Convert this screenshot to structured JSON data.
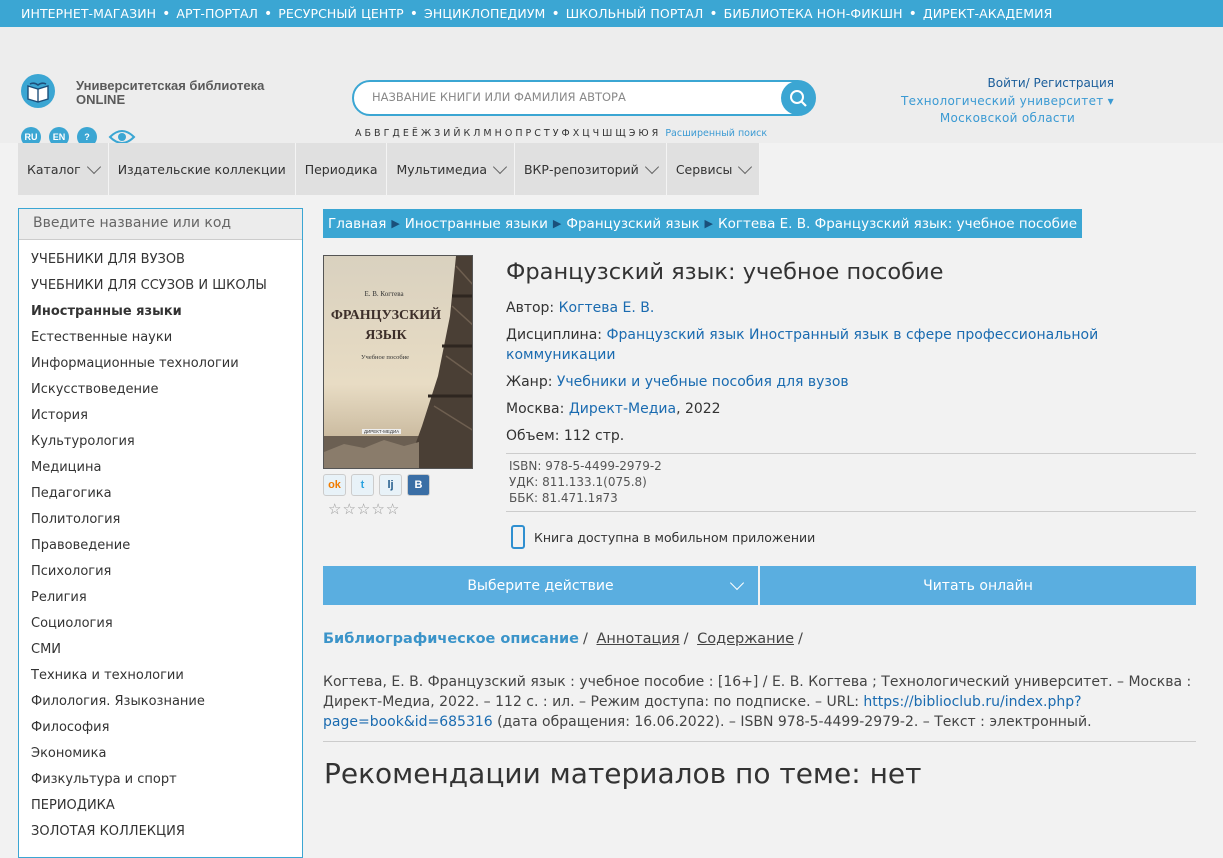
{
  "topbar": {
    "links": [
      "ИНТЕРНЕТ-МАГАЗИН",
      "АРТ-ПОРТАЛ",
      "РЕСУРСНЫЙ ЦЕНТР",
      "ЭНЦИКЛОПЕДИУМ",
      "ШКОЛЬНЫЙ ПОРТАЛ",
      "БИБЛИОТЕКА НОН-ФИКШН",
      "ДИРЕКТ-АКАДЕМИЯ"
    ]
  },
  "header": {
    "logo_line1": "Университетская библиотека",
    "logo_line2": "ONLINE",
    "lang": {
      "ru": "RU",
      "en": "EN",
      "help": "?"
    },
    "search_placeholder": "НАЗВАНИЕ КНИГИ ИЛИ ФАМИЛИЯ АВТОРА",
    "alphabet": "А Б В Г Д Е Ё Ж З И Й К Л М Н О П Р С Т У Ф Х Ц Ч Ш Щ Э Ю Я",
    "advanced_search": "Расширенный поиск",
    "login": "Войти/ Регистрация",
    "org_line1": "Технологический университет ▾",
    "org_line2": "Московской области"
  },
  "nav": {
    "catalog": "Каталог",
    "collections": "Издательские коллекции",
    "periodicals": "Периодика",
    "multimedia": "Мультимедиа",
    "vkr": "ВКР-репозиторий",
    "services": "Сервисы"
  },
  "sidebar": {
    "search_placeholder": "Введите название или код",
    "items": [
      "УЧЕБНИКИ ДЛЯ ВУЗОВ",
      "УЧЕБНИКИ ДЛЯ ССУЗОВ И ШКОЛЫ",
      "Иностранные языки",
      "Естественные науки",
      "Информационные технологии",
      "Искусствоведение",
      "История",
      "Культурология",
      "Медицина",
      "Педагогика",
      "Политология",
      "Правоведение",
      "Психология",
      "Религия",
      "Социология",
      "СМИ",
      "Техника и технологии",
      "Филология. Языкознание",
      "Философия",
      "Экономика",
      "Физкультура и спорт",
      "ПЕРИОДИКА",
      "ЗОЛОТАЯ КОЛЛЕКЦИЯ"
    ],
    "active": "Иностранные языки"
  },
  "breadcrumb": [
    "Главная",
    "Иностранные языки",
    "Французский язык",
    "Когтева Е. В. Французский язык: учебное пособие"
  ],
  "book": {
    "cover_author": "Е. В. Когтева",
    "cover_title_1": "ФРАНЦУЗСКИЙ",
    "cover_title_2": "ЯЗЫК",
    "cover_subtitle": "Учебное пособие",
    "cover_publisher": "ДИРЕКТ-МЕДИА",
    "title": "Французский язык: учебное пособие",
    "author_label": "Автор:",
    "author": "Когтева Е. В.",
    "discipline_label": "Дисциплина:",
    "discipline_1": "Французский язык",
    "discipline_2": "Иностранный язык в сфере профессиональной",
    "discipline_3": "коммуникации",
    "genre_label": "Жанр:",
    "genre": "Учебники и учебные пособия для вузов",
    "place": "Москва:",
    "publisher": "Директ-Медиа",
    "year": ", 2022",
    "volume": "Объем: 112 стр.",
    "isbn": "ISBN: 978-5-4499-2979-2",
    "udk": "УДК: 811.133.1(075.8)",
    "bbk": "ББК: 81.471.1я73",
    "mobile": "Книга доступна в мобильном приложении",
    "rating_stars": 0
  },
  "share_icons": [
    "odnoklassniki-icon",
    "twitter-icon",
    "livejournal-icon",
    "vkontakte-icon"
  ],
  "actions": {
    "choose": "Выберите действие",
    "read": "Читать онлайн"
  },
  "tabs": {
    "biblio": "Библиографическое описание",
    "annotation": "Аннотация",
    "contents": "Содержание"
  },
  "biblio": {
    "text_1": "Когтева, Е. В. Французский язык : учебное пособие : [16+] / Е. В. Когтева ; Технологический университет. – Москва : Директ-Медиа, 2022. – 112 с. : ил. – Режим доступа: по подписке. – URL: ",
    "url_1": "https://biblioclub.ru/index.php?",
    "url_2": "page=book&id=685316",
    "text_2": " (дата обращения: 16.06.2022). – ISBN 978-5-4499-2979-2. – Текст : электронный."
  },
  "recommend": "Рекомендации материалов по теме: нет",
  "colors": {
    "accent": "#3ba6d3",
    "button": "#5aaee0",
    "link": "#1a6bb0"
  }
}
